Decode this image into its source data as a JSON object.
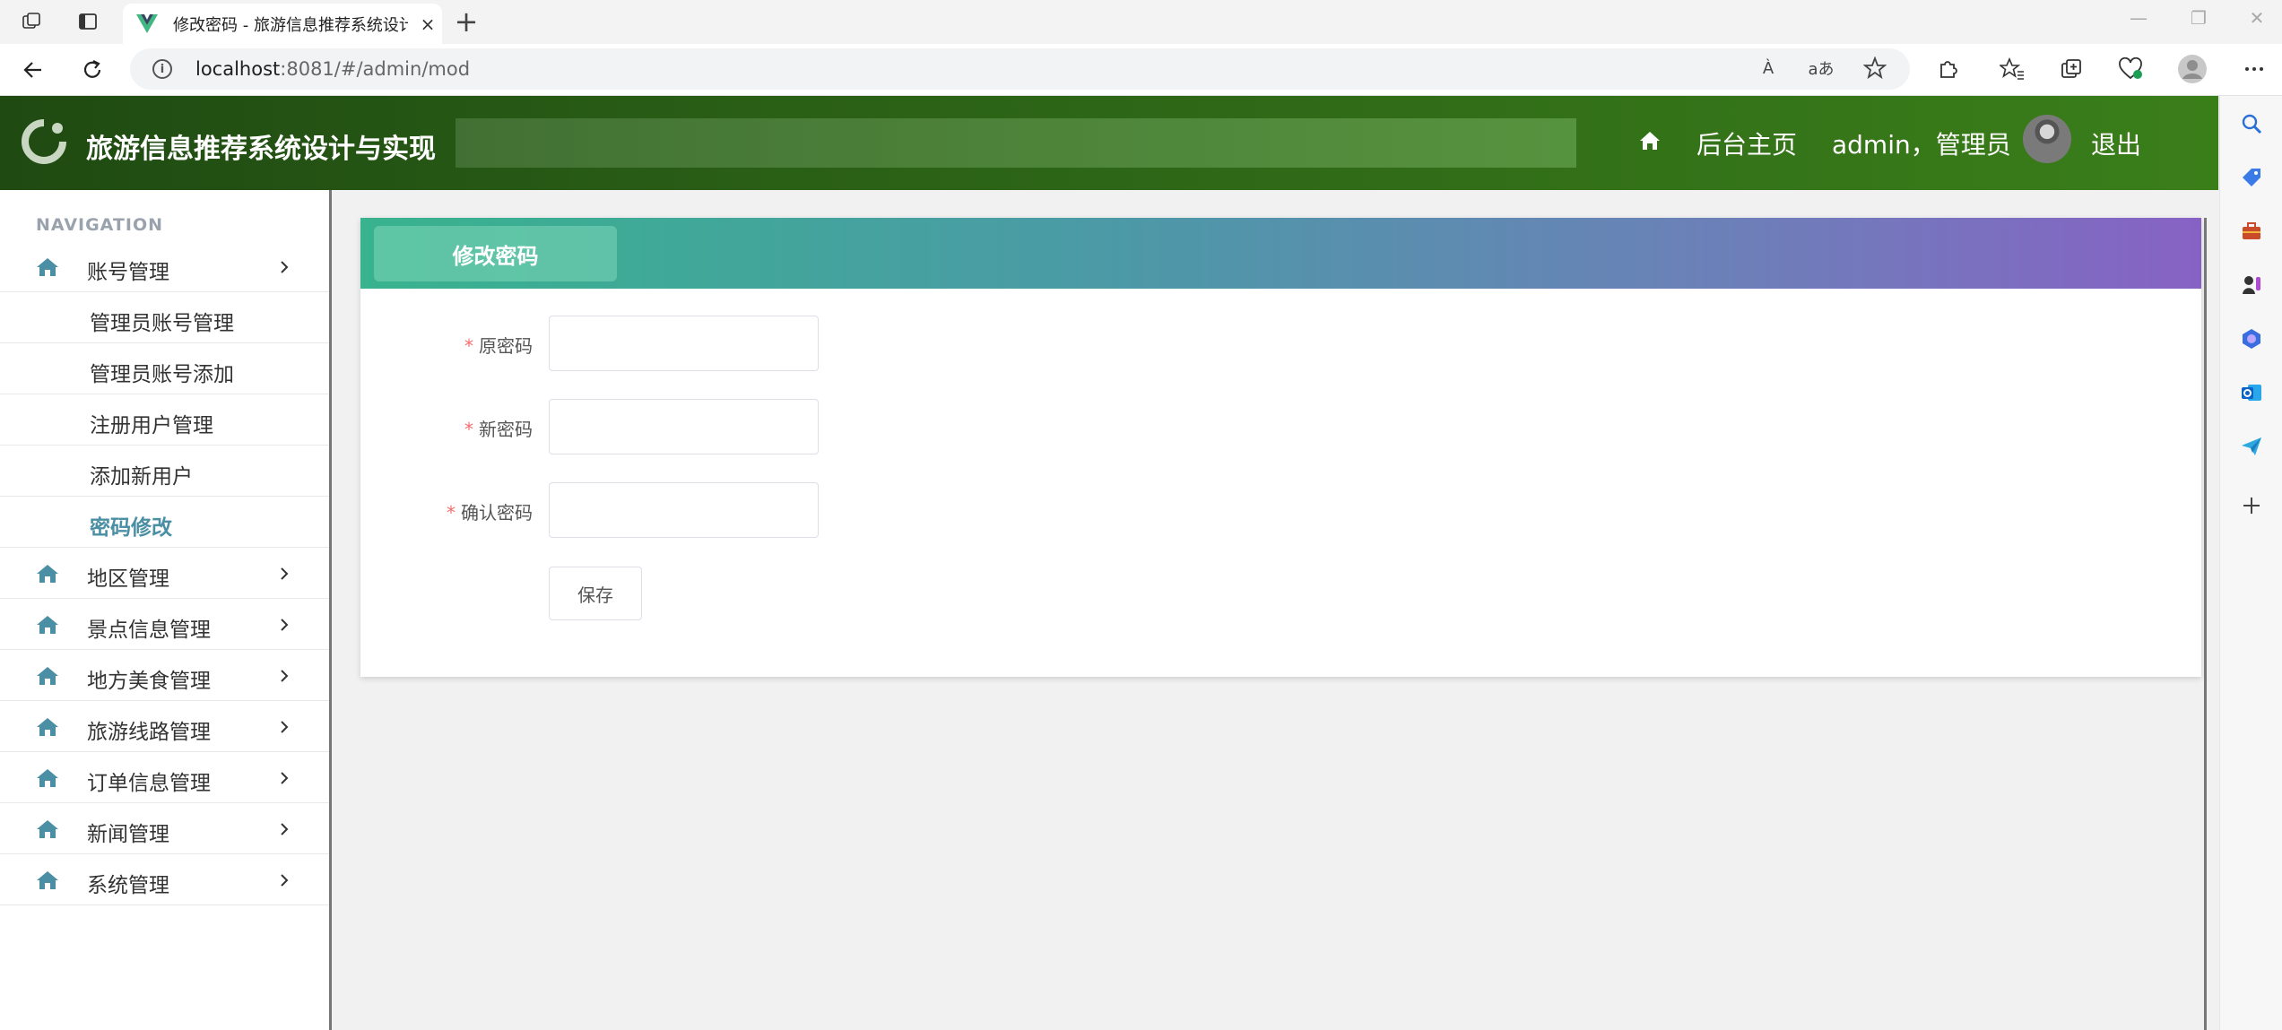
{
  "browser": {
    "tab_title": "修改密码 - 旅游信息推荐系统设计与实现",
    "tab_close": "×",
    "new_tab": "+",
    "url_host": "localhost",
    "url_rest": ":8081/#/admin/mod",
    "read_aloud": "À",
    "translate": "aあ"
  },
  "header": {
    "title": "旅游信息推荐系统设计与实现",
    "home_link": "后台主页",
    "user": "admin，管理员",
    "logout": "退出"
  },
  "sidebar": {
    "heading": "NAVIGATION",
    "groups": [
      {
        "label": "账号管理",
        "expanded": true,
        "children": [
          "管理员账号管理",
          "管理员账号添加",
          "注册用户管理",
          "添加新用户",
          "密码修改"
        ],
        "active_child": "密码修改"
      },
      {
        "label": "地区管理"
      },
      {
        "label": "景点信息管理"
      },
      {
        "label": "地方美食管理"
      },
      {
        "label": "旅游线路管理"
      },
      {
        "label": "订单信息管理"
      },
      {
        "label": "新闻管理"
      },
      {
        "label": "系统管理"
      }
    ]
  },
  "panel": {
    "tab_label": "修改密码",
    "required_mark": "*",
    "fields": [
      {
        "label": "原密码",
        "value": "",
        "placeholder": ""
      },
      {
        "label": "新密码",
        "value": "",
        "placeholder": ""
      },
      {
        "label": "确认密码",
        "value": "",
        "placeholder": ""
      }
    ],
    "save_label": "保存"
  },
  "colors": {
    "header_start": "#1f4a12",
    "header_end": "#3a7e1a",
    "panel_start": "#38b38e",
    "panel_end": "#8762c4",
    "active_menu": "#4b8fa4",
    "required": "#f56c6c",
    "icon": "#4b8fa4"
  },
  "icons": {
    "workspaces": "workspaces-icon",
    "tab_actions": "tab-actions-icon",
    "favicon": "vue-favicon-icon",
    "back": "back-arrow-icon",
    "reload": "reload-icon",
    "info": "info-icon",
    "favorites": "star-icon",
    "extensions": "puzzle-icon",
    "collections": "collections-icon",
    "profile": "profile-icon",
    "menu_home": "home-icon",
    "menu_arrow": "chevron-right-icon"
  }
}
